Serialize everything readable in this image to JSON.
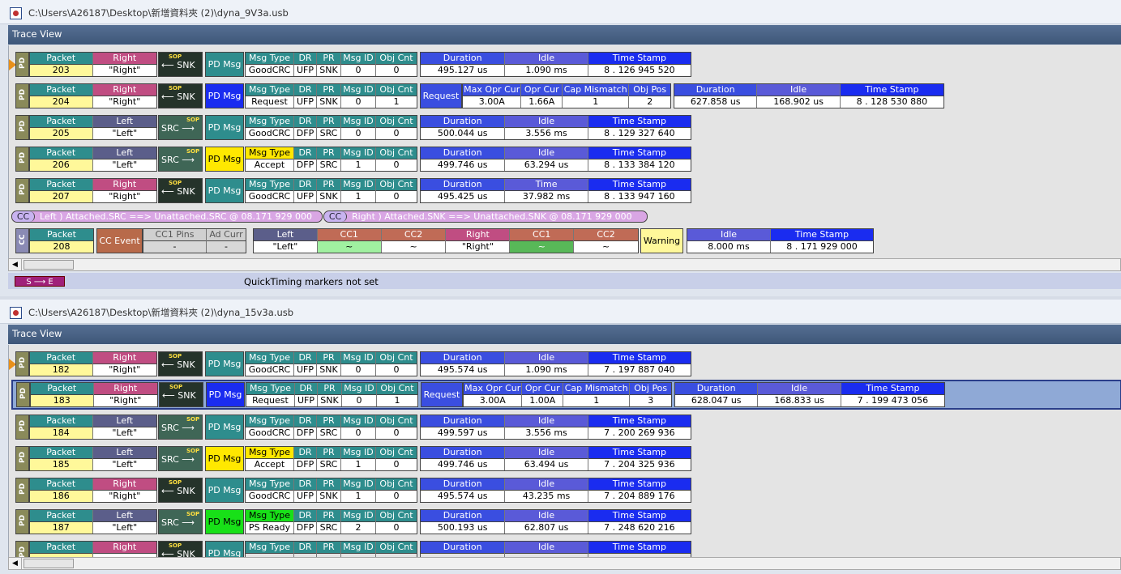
{
  "windows": [
    {
      "path": "C:\\Users\\A26187\\Desktop\\新增資料夾 (2)\\dyna_9V3a.usb",
      "trace_view_label": "Trace View",
      "quicktiming": "QuickTiming markers not set",
      "se_label": "S ⟶ E"
    },
    {
      "path": "C:\\Users\\A26187\\Desktop\\新增資料夾 (2)\\dyna_15v3a.usb",
      "trace_view_label": "Trace View"
    }
  ],
  "headers": {
    "packet": "Packet",
    "right": "Right",
    "left": "Left",
    "pd": "PD",
    "pd_msg": "PD Msg",
    "msg_type": "Msg Type",
    "dr": "DR",
    "pr": "PR",
    "msg_id": "Msg ID",
    "obj_cnt": "Obj Cnt",
    "duration": "Duration",
    "idle": "Idle",
    "time": "Time",
    "time_stamp": "Time Stamp",
    "request": "Request",
    "max_opr_cur": "Max Opr Cur",
    "opr_cur": "Opr Cur",
    "cap_mismatch": "Cap Mismatch",
    "obj_pos": "Obj Pos",
    "cc": "CC",
    "cc_event": "CC Event",
    "cc1_pins": "CC1 Pins",
    "ad_curr": "Ad Curr",
    "cc1": "CC1",
    "cc2": "CC2",
    "warning": "Warning",
    "sop": "SOP",
    "snk": "SNK",
    "src": "SRC"
  },
  "trace1": {
    "p203": {
      "packet": "203",
      "dir": "\"Right\"",
      "msg": "GoodCRC",
      "dr": "UFP",
      "pr": "SNK",
      "id": "0",
      "cnt": "0",
      "dur": "495.127 us",
      "idle": "1.090 ms",
      "ts": "8 . 126 945 520"
    },
    "p204": {
      "packet": "204",
      "dir": "\"Right\"",
      "msg": "Request",
      "dr": "UFP",
      "pr": "SNK",
      "id": "0",
      "cnt": "1",
      "max": "3.00A",
      "opr": "1.66A",
      "cap": "1",
      "pos": "2",
      "dur": "627.858 us",
      "idle": "168.902 us",
      "ts": "8 . 128 530 880"
    },
    "p205": {
      "packet": "205",
      "dir": "\"Left\"",
      "msg": "GoodCRC",
      "dr": "DFP",
      "pr": "SRC",
      "id": "0",
      "cnt": "0",
      "dur": "500.044 us",
      "idle": "3.556 ms",
      "ts": "8 . 129 327 640"
    },
    "p206": {
      "packet": "206",
      "dir": "\"Left\"",
      "msg": "Accept",
      "dr": "DFP",
      "pr": "SRC",
      "id": "1",
      "cnt": "0",
      "dur": "499.746 us",
      "idle": "63.294 us",
      "ts": "8 . 133 384 120"
    },
    "p207": {
      "packet": "207",
      "dir": "\"Right\"",
      "msg": "GoodCRC",
      "dr": "UFP",
      "pr": "SNK",
      "id": "1",
      "cnt": "0",
      "dur": "495.425 us",
      "idle": "37.982 ms",
      "ts": "8 . 133 947 160"
    },
    "cc_left": "Left ) Attached.SRC ==> Unattached.SRC @ 08.171 929 000",
    "cc_right": "Right ) Attached.SNK ==> Unattached.SNK @ 08.171 929 000",
    "p208": {
      "packet": "208",
      "pins": "-",
      "adc": "-",
      "left": "\"Left\"",
      "cc1l": "~",
      "cc2l": "~",
      "right": "\"Right\"",
      "cc1r": "~",
      "cc2r": "~",
      "idle": "8.000 ms",
      "ts": "8 . 171 929 000"
    }
  },
  "trace2": {
    "p182": {
      "packet": "182",
      "dir": "\"Right\"",
      "msg": "GoodCRC",
      "dr": "UFP",
      "pr": "SNK",
      "id": "0",
      "cnt": "0",
      "dur": "495.574 us",
      "idle": "1.090 ms",
      "ts": "7 . 197 887 040"
    },
    "p183": {
      "packet": "183",
      "dir": "\"Right\"",
      "msg": "Request",
      "dr": "UFP",
      "pr": "SNK",
      "id": "0",
      "cnt": "1",
      "max": "3.00A",
      "opr": "1.00A",
      "cap": "1",
      "pos": "3",
      "dur": "628.047 us",
      "idle": "168.833 us",
      "ts": "7 . 199 473 056"
    },
    "p184": {
      "packet": "184",
      "dir": "\"Left\"",
      "msg": "GoodCRC",
      "dr": "DFP",
      "pr": "SRC",
      "id": "0",
      "cnt": "0",
      "dur": "499.597 us",
      "idle": "3.556 ms",
      "ts": "7 . 200 269 936"
    },
    "p185": {
      "packet": "185",
      "dir": "\"Left\"",
      "msg": "Accept",
      "dr": "DFP",
      "pr": "SRC",
      "id": "1",
      "cnt": "0",
      "dur": "499.746 us",
      "idle": "63.494 us",
      "ts": "7 . 204 325 936"
    },
    "p186": {
      "packet": "186",
      "dir": "\"Right\"",
      "msg": "GoodCRC",
      "dr": "UFP",
      "pr": "SNK",
      "id": "1",
      "cnt": "0",
      "dur": "495.574 us",
      "idle": "43.235 ms",
      "ts": "7 . 204 889 176"
    },
    "p187": {
      "packet": "187",
      "dir": "\"Left\"",
      "msg": "PS Ready",
      "dr": "DFP",
      "pr": "SRC",
      "id": "2",
      "cnt": "0",
      "dur": "500.193 us",
      "idle": "62.807 us",
      "ts": "7 . 248 620 216"
    },
    "p188": {
      "packet": "",
      "dir": ""
    }
  },
  "colors": {
    "pd_msg_goodcrc": "#2e8d8d",
    "pd_msg_request": "#1a2cf0",
    "pd_msg_accept": "#ffe800",
    "pd_msg_psready": "#18e018",
    "right": "#c04d82",
    "left": "#5b5e8a"
  }
}
